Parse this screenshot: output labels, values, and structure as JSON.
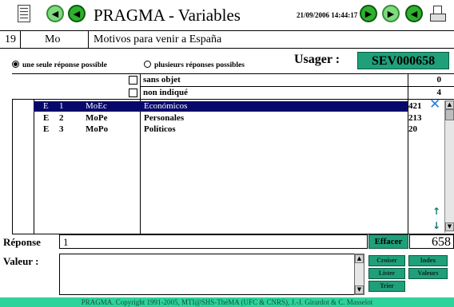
{
  "toolbar": {
    "title": "PRAGMA - Variables",
    "datetime": "21/09/2006 14:44:17",
    "icons": [
      "notepad-icon",
      "back-icon",
      "prev-icon",
      "next-icon",
      "forward-icon",
      "last-icon",
      "print-icon"
    ]
  },
  "variable": {
    "number": "19",
    "code": "Mo",
    "label": "Motivos para venir a España"
  },
  "options": {
    "single": "une seule réponse possible",
    "multiple": "plusieurs réponses possibles",
    "single_selected": true
  },
  "usager": {
    "label": "Usager :",
    "value": "SEV000658"
  },
  "special_rows": [
    {
      "label": "sans objet",
      "count": "0"
    },
    {
      "label": "non indiqué",
      "count": "4"
    }
  ],
  "rows": [
    {
      "type": "E",
      "num": "1",
      "code": "MoEc",
      "label": "Económicos",
      "count": "421",
      "selected": true
    },
    {
      "type": "E",
      "num": "2",
      "code": "MoPe",
      "label": "Personales",
      "count": "213",
      "selected": false
    },
    {
      "type": "E",
      "num": "3",
      "code": "MoPo",
      "label": "Políticos",
      "count": "20",
      "selected": false
    }
  ],
  "response": {
    "label": "Réponse",
    "value": "1",
    "clear_label": "Effacer",
    "total": "658"
  },
  "valeur": {
    "label": "Valeur :",
    "value": ""
  },
  "actions": {
    "croiser": "Croiser",
    "index": "Index",
    "lister": "Lister",
    "valeurs": "Valeurs",
    "trier": "Trier"
  },
  "footer": "PRAGMA. Copyright 1991-2005, MTI@SHS-ThéMA (UFC & CNRS), J.-J. Girardot & C. Masselot",
  "colors": {
    "accent": "#1fa07a",
    "selection": "#08086b",
    "button_green": "#2fb02f",
    "footer": "#2dd39a"
  }
}
